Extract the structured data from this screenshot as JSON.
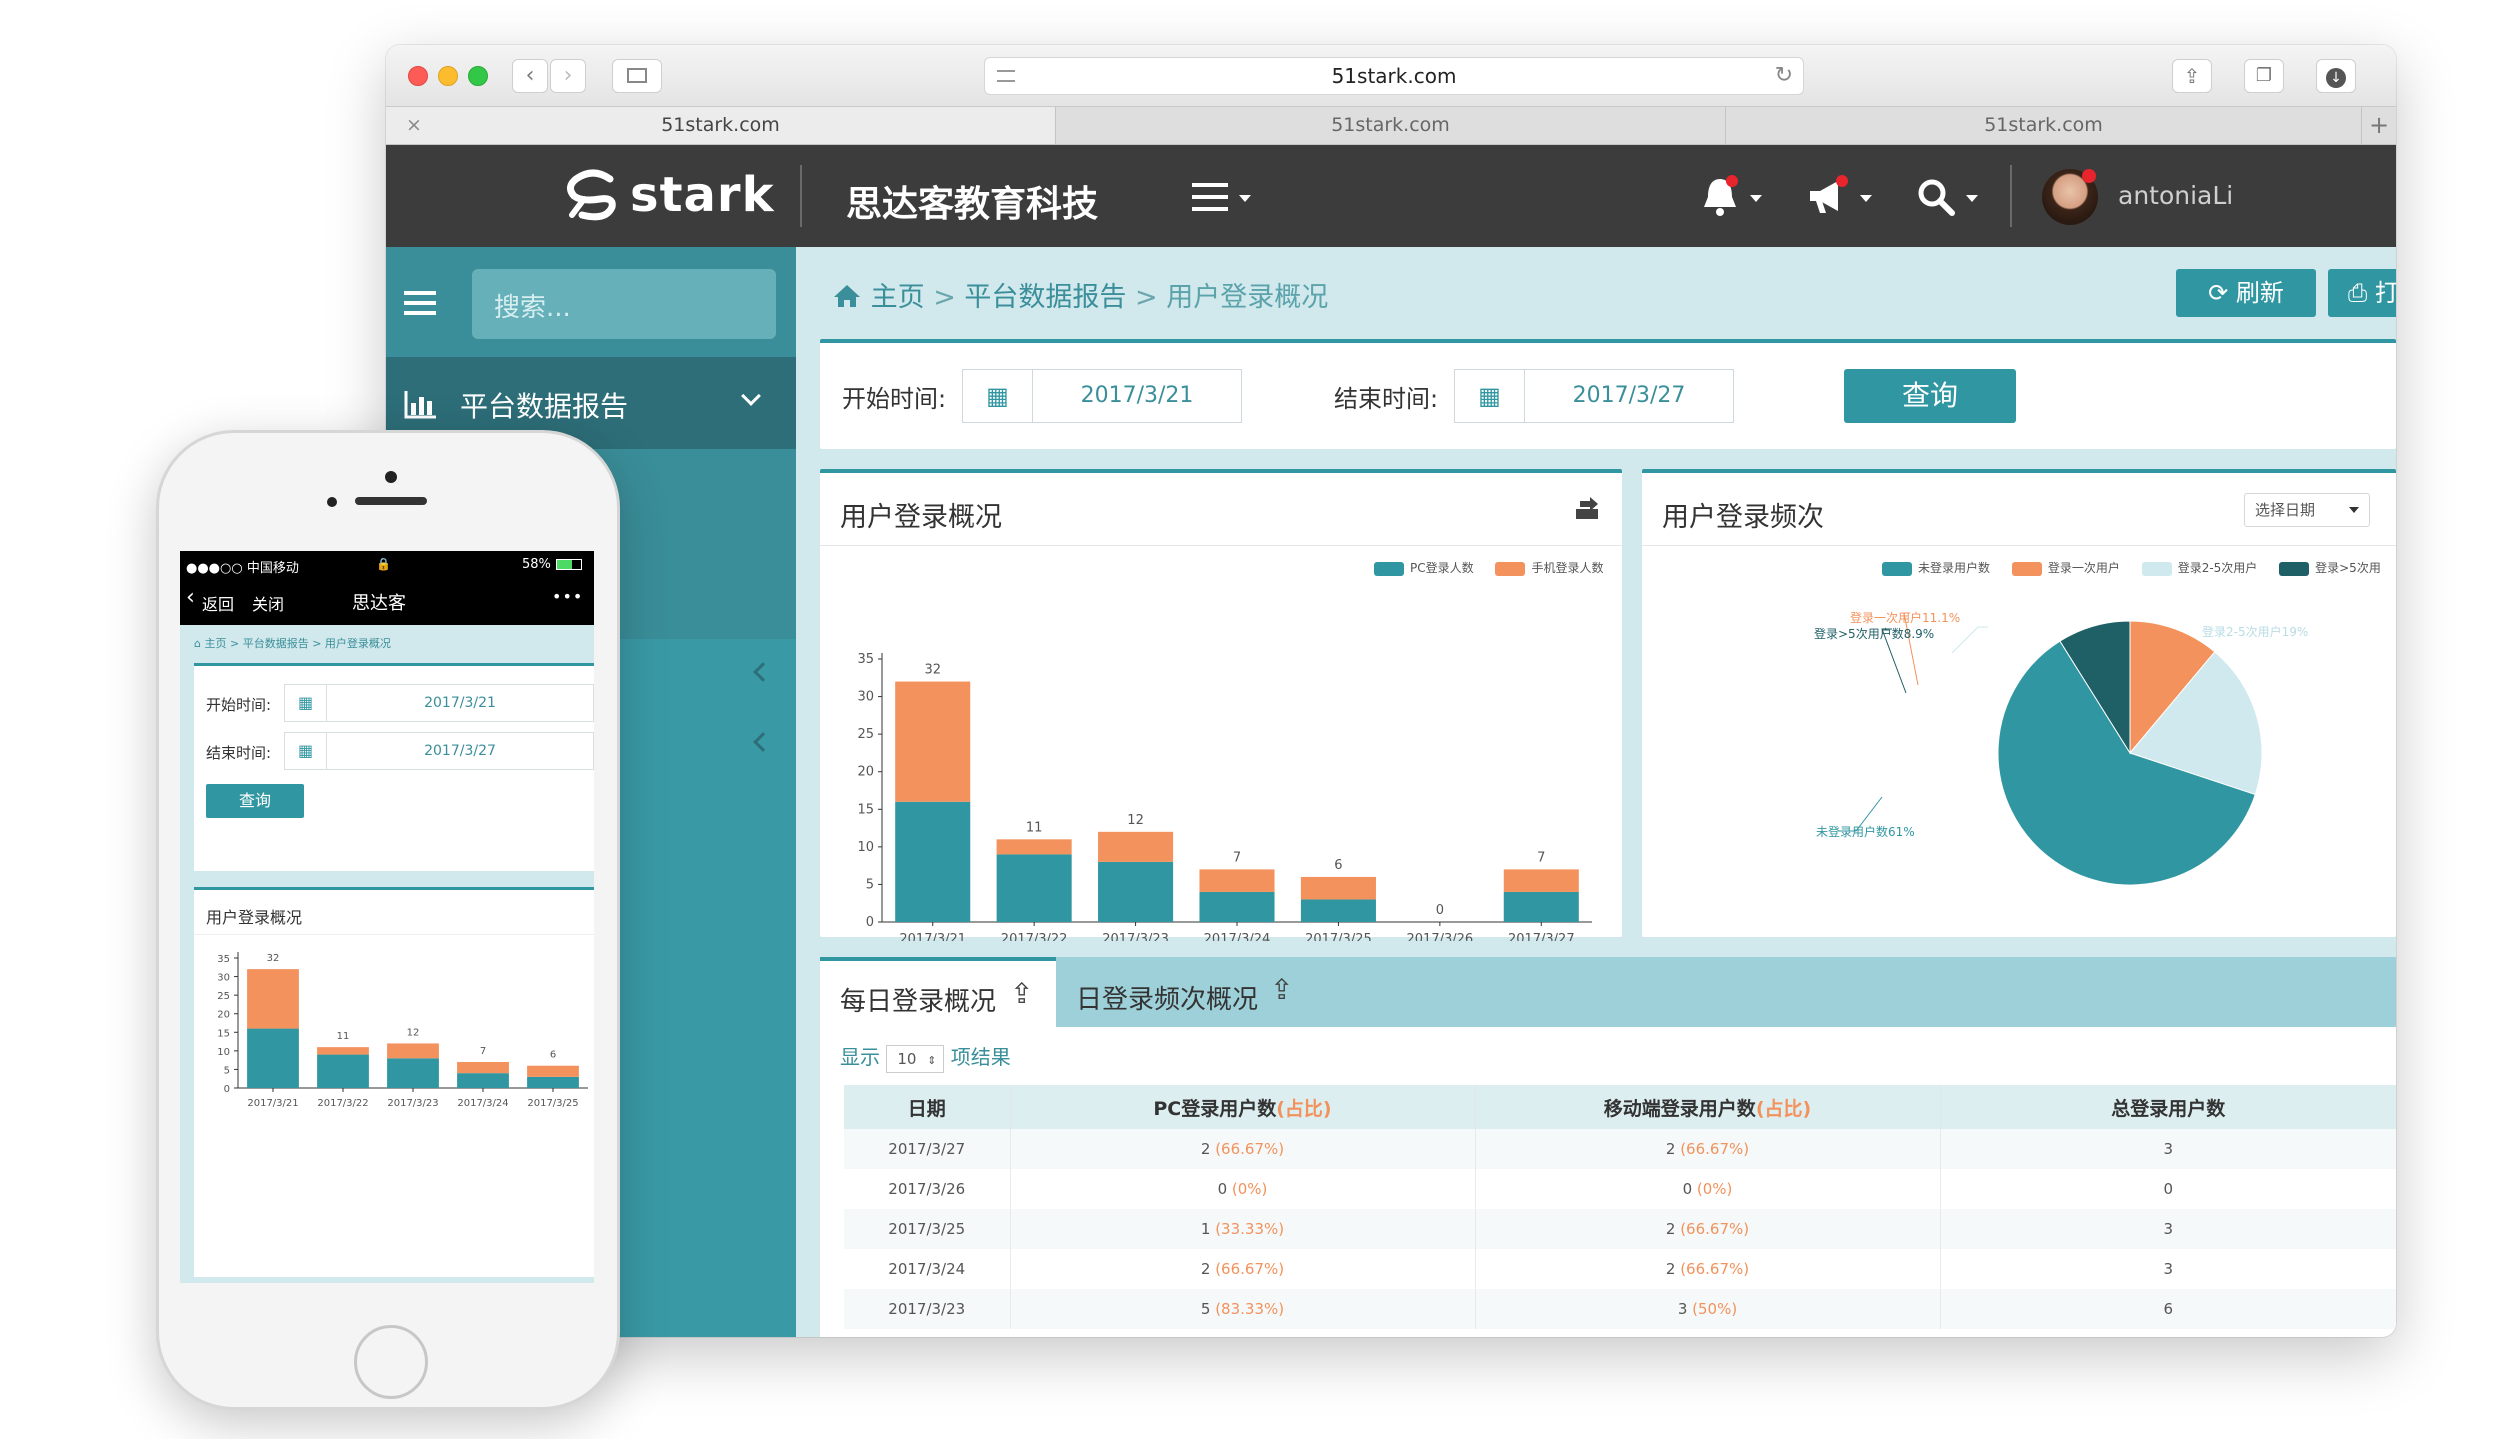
{
  "browser": {
    "url": "51stark.com",
    "tabs": [
      "51stark.com",
      "51stark.com",
      "51stark.com"
    ]
  },
  "header": {
    "brand": "stark",
    "company": "思达客教育科技",
    "username": "antoniaLi"
  },
  "sidebar": {
    "search_placeholder": "搜索...",
    "menu_item": "平台数据报告"
  },
  "breadcrumb": {
    "home": "主页",
    "sep1": ">",
    "section": "平台数据报告",
    "sep2": ">",
    "current": "用户登录概况"
  },
  "actions": {
    "refresh": "刷新",
    "print": "打"
  },
  "filter": {
    "start_label": "开始时间:",
    "start_value": "2017/3/21",
    "end_label": "结束时间:",
    "end_value": "2017/3/27",
    "query": "查询"
  },
  "login_card": {
    "title": "用户登录概况",
    "legend": [
      "PC登录人数",
      "手机登录人数"
    ]
  },
  "freq_card": {
    "title": "用户登录频次",
    "select_label": "选择日期",
    "legend": [
      "未登录用户数",
      "登录一次用户",
      "登录2-5次用户",
      "登录>5次用"
    ],
    "labels": {
      "once": "登录一次用户11.1%",
      "gt5": "登录>5次用户数8.9%",
      "two_five": "登录2-5次用户19%",
      "none": "未登录用户数61%"
    }
  },
  "table_card": {
    "tabs": [
      "每日登录概况",
      "日登录频次概况"
    ],
    "show_prefix": "显示",
    "page_size": "10",
    "show_suffix": "项结果",
    "columns": [
      "日期",
      "PC登录用户数",
      "(占比)",
      "移动端登录用户数",
      "(占比)",
      "总登录用户数"
    ],
    "rows": [
      {
        "date": "2017/3/27",
        "pc": "2",
        "pc_pct": "(66.67%)",
        "mobile": "2",
        "mobile_pct": "(66.67%)",
        "total": "3"
      },
      {
        "date": "2017/3/26",
        "pc": "0",
        "pc_pct": "(0%)",
        "mobile": "0",
        "mobile_pct": "(0%)",
        "total": "0"
      },
      {
        "date": "2017/3/25",
        "pc": "1",
        "pc_pct": "(33.33%)",
        "mobile": "2",
        "mobile_pct": "(66.67%)",
        "total": "3"
      },
      {
        "date": "2017/3/24",
        "pc": "2",
        "pc_pct": "(66.67%)",
        "mobile": "2",
        "mobile_pct": "(66.67%)",
        "total": "3"
      },
      {
        "date": "2017/3/23",
        "pc": "5",
        "pc_pct": "(83.33%)",
        "mobile": "3",
        "mobile_pct": "(50%)",
        "total": "6"
      }
    ]
  },
  "phone": {
    "status_left": "●●●○○ 中国移动",
    "status_right": "58%",
    "back": "返回",
    "close": "关闭",
    "title": "思达客",
    "more": "•••",
    "breadcrumb": "主页 > 平台数据报告 > 用户登录概况",
    "start_label": "开始时间:",
    "start_value": "2017/3/21",
    "end_label": "结束时间:",
    "end_value": "2017/3/27",
    "query": "查询",
    "chart_title": "用户登录概况"
  },
  "colors": {
    "teal": "#3097a2",
    "dark_teal": "#1f5f66",
    "orange": "#f3925c",
    "light_blue": "#cfe9ee",
    "header": "#3c3c3c",
    "sidebar": "#399aa6"
  },
  "chart_data": [
    {
      "type": "bar",
      "categories": [
        "2017/3/21",
        "2017/3/22",
        "2017/3/23",
        "2017/3/24",
        "2017/3/25",
        "2017/3/26",
        "2017/3/27"
      ],
      "series": [
        {
          "name": "PC登录人数",
          "values": [
            16,
            9,
            8,
            4,
            3,
            0,
            4
          ]
        },
        {
          "name": "手机登录人数",
          "values": [
            16,
            2,
            4,
            3,
            3,
            0,
            3
          ]
        }
      ],
      "totals": [
        32,
        11,
        12,
        7,
        6,
        0,
        7
      ],
      "yticks": [
        0,
        5,
        10,
        15,
        20,
        25,
        30,
        35
      ],
      "ylim": [
        0,
        35
      ],
      "stacked": true
    },
    {
      "type": "pie",
      "slices": [
        {
          "name": "未登录用户数",
          "value": 61
        },
        {
          "name": "登录一次用户",
          "value": 11.1
        },
        {
          "name": "登录2-5次用户",
          "value": 19
        },
        {
          "name": "登录>5次用户数",
          "value": 8.9
        }
      ]
    },
    {
      "type": "bar",
      "categories": [
        "2017/3/21",
        "2017/3/22",
        "2017/3/23",
        "2017/3/24",
        "2017/3/25"
      ],
      "series": [
        {
          "name": "PC登录人数",
          "values": [
            16,
            9,
            8,
            4,
            3
          ]
        },
        {
          "name": "手机登录人数",
          "values": [
            16,
            2,
            4,
            3,
            3
          ]
        }
      ],
      "totals": [
        32,
        11,
        12,
        7,
        6
      ],
      "yticks": [
        0,
        5,
        10,
        15,
        20,
        25,
        30,
        35
      ],
      "ylim": [
        0,
        35
      ],
      "stacked": true
    }
  ]
}
